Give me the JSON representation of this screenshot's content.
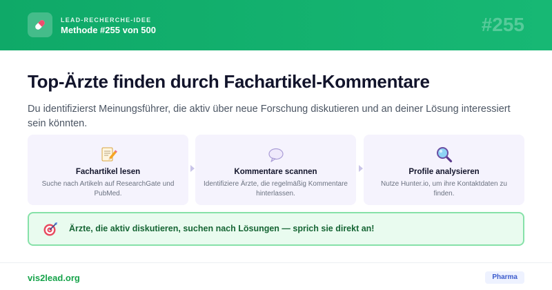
{
  "header": {
    "kicker": "LEAD-RECHERCHE-IDEE",
    "method": "Methode #255 von 500",
    "number": "#255",
    "logo_icon": "pill-icon"
  },
  "main": {
    "title": "Top-Ärzte finden durch Fachartikel-Kommentare",
    "subtitle": "Du identifizierst Meinungsführer, die aktiv über neue Forschung diskutieren und an deiner Lösung interessiert sein könnten."
  },
  "steps": [
    {
      "icon": "memo-pencil-icon",
      "title": "Fachartikel lesen",
      "desc": "Suche nach Artikeln auf ResearchGate und PubMed."
    },
    {
      "icon": "speech-bubble-icon",
      "title": "Kommentare scannen",
      "desc": "Identifiziere Ärzte, die regelmäßig Kommentare hinterlassen."
    },
    {
      "icon": "magnifier-icon",
      "title": "Profile analysieren",
      "desc": "Nutze Hunter.io, um ihre Kontaktdaten zu finden."
    }
  ],
  "callout": {
    "icon": "target-dart-icon",
    "text": "Ärzte, die aktiv diskutieren, suchen nach Lösungen — sprich sie direkt an!"
  },
  "footer": {
    "brand": "vis2lead.org",
    "tag": "Pharma"
  },
  "colors": {
    "header_green": "#0fa968",
    "step_bg": "#f5f3fd",
    "callout_bg": "#e9fbef",
    "callout_border": "#86e1a8",
    "callout_text": "#166534",
    "brand_green": "#16a34a",
    "tag_bg": "#eef2ff",
    "tag_text": "#3b5bcc"
  }
}
